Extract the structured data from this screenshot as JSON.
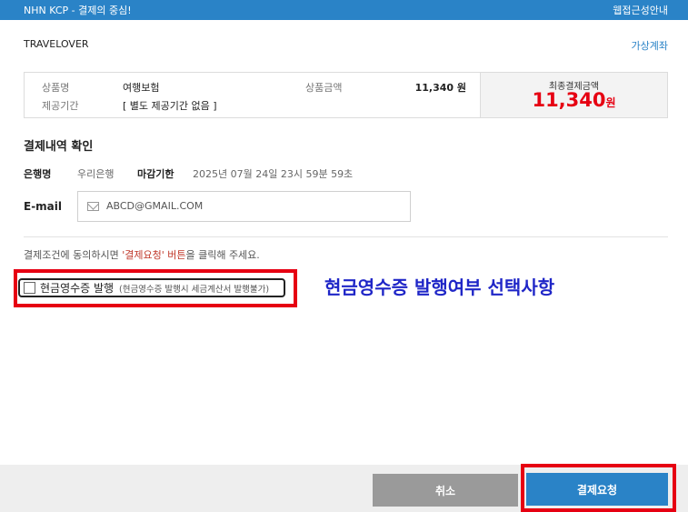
{
  "header": {
    "brand": "NHN KCP - 결제의 중심!",
    "accessibility_link": "웹접근성안내"
  },
  "merchant": {
    "name": "TRAVELOVER",
    "virtual_account_link": "가상계좌"
  },
  "product": {
    "name_label": "상품명",
    "name_value": "여행보험",
    "period_label": "제공기간",
    "period_value": "[ 별도 제공기간 없음 ]",
    "amount_label": "상품금액",
    "amount_value": "11,340 원",
    "final_label": "최종결제금액",
    "final_amount": "11,340",
    "final_unit": "원"
  },
  "confirm": {
    "title": "결제내역 확인",
    "bank_label": "은행명",
    "bank_value": "우리은행",
    "deadline_label": "마감기한",
    "deadline_value": "2025년 07월 24일 23시 59분 59초",
    "email_label": "E-mail",
    "email_value": "ABCD@GMAIL.COM"
  },
  "notice": {
    "prefix": "결제조건에 동의하시면 ",
    "highlight": "'결제요청' 버튼",
    "suffix": "을 클릭해 주세요."
  },
  "receipt": {
    "label": "현금영수증 발행",
    "note": "(현금영수증 발행시 세금계산서 발행불가)",
    "checked": false
  },
  "annotation": "현금영수증 발행여부 선택사항",
  "buttons": {
    "cancel": "취소",
    "pay": "결제요청"
  },
  "colors": {
    "accent": "#2a83c7",
    "highlight_red": "#e60012",
    "annotation_blue": "#1f26c7",
    "cancel_gray": "#9a9a9a"
  }
}
